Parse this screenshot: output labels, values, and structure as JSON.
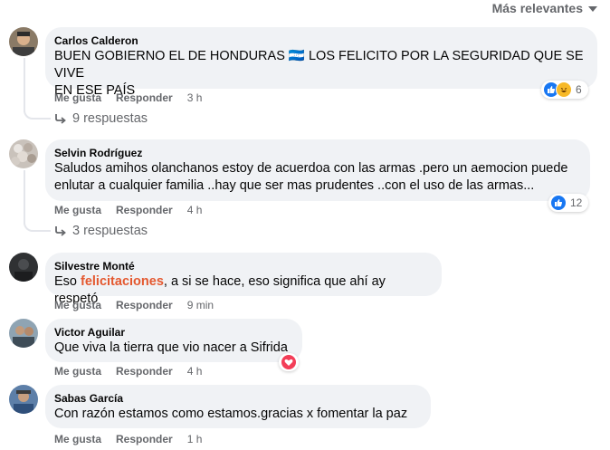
{
  "header": {
    "sort_label": "Más relevantes"
  },
  "actions": {
    "like": "Me gusta",
    "reply": "Responder"
  },
  "comments": [
    {
      "author": "Carlos Calderon",
      "text_line1": "BUEN GOBIERNO EL DE HONDURAS 🇭🇳 LOS FELICITO POR LA SEGURIDAD QUE SE VIVE",
      "text_line2": "EN ESE PAÍS",
      "time": "3 h",
      "reaction_count": "6",
      "replies_label": "9 respuestas"
    },
    {
      "author": "Selvin Rodríguez",
      "text_line1": "Saludos amihos olanchanos estoy de acuerdoa con las armas .pero un aemocion puede",
      "text_line2": "enlutar a cualquier familia ..hay que ser mas prudentes ..con el uso de las armas...",
      "time": "4 h",
      "reaction_count": "12",
      "replies_label": "3 respuestas"
    },
    {
      "author": "Silvestre Monté",
      "text_pre": "Eso ",
      "text_highlight": "felicitaciones",
      "text_post": ", a si se hace, eso significa que ahí ay respetó",
      "time": "9 min"
    },
    {
      "author": "Victor Aguilar",
      "text": "Que viva la tierra que vio nacer a Sifrida",
      "time": "4 h"
    },
    {
      "author": "Sabas García",
      "text": "Con razón estamos como estamos.gracias x fomentar la paz",
      "time": "1 h"
    }
  ],
  "colors": {
    "bubble": "#f0f2f5",
    "meta_text": "#65676b",
    "like_blue": "#1877f2",
    "love_red": "#f33e58",
    "highlight": "#e4582f"
  }
}
